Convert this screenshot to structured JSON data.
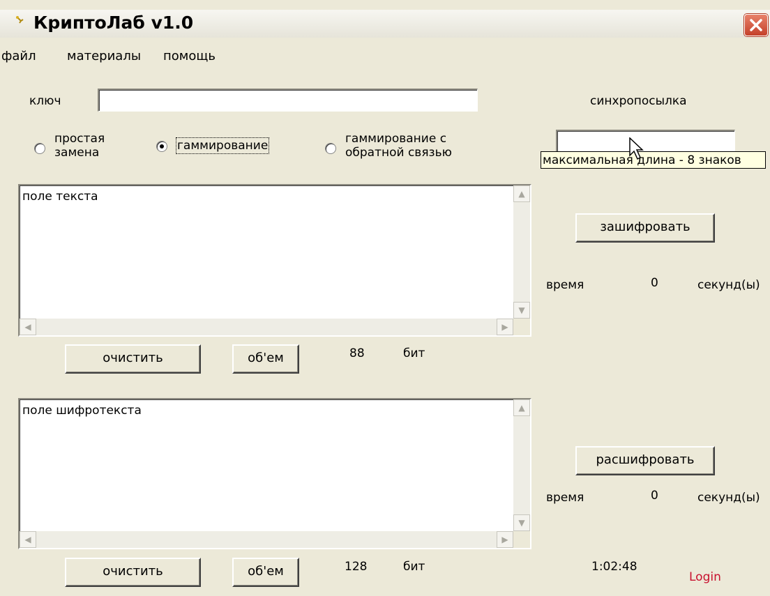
{
  "window": {
    "title": "КриптоЛаб v1.0"
  },
  "menu": {
    "items": [
      "файл",
      "материалы",
      "помощь"
    ]
  },
  "key": {
    "label": "ключ",
    "value": ""
  },
  "sync": {
    "label": "синхропосылка",
    "value": "",
    "tooltip": "максимальная длина - 8 знаков"
  },
  "modes": {
    "simple": {
      "line1": "простая",
      "line2": "замена",
      "checked": false
    },
    "gamma": {
      "label": "гаммирование",
      "checked": true
    },
    "feedback": {
      "line1": "гаммирование с",
      "line2": "обратной связью",
      "checked": false
    }
  },
  "plaintext": {
    "text": "поле текста",
    "clear_label": "очистить",
    "volume_label": "об'ем",
    "bits": "88",
    "bits_unit": "бит"
  },
  "ciphertext": {
    "text": "поле шифротекста",
    "clear_label": "очистить",
    "volume_label": "об'ем",
    "bits": "128",
    "bits_unit": "бит"
  },
  "encrypt": {
    "label": "зашифровать",
    "time_label": "время",
    "time_value": "0",
    "time_unit": "секунд(ы)"
  },
  "decrypt": {
    "label": "расшифровать",
    "time_label": "время",
    "time_value": "0",
    "time_unit": "секунд(ы)"
  },
  "status": {
    "clock": "1:02:48",
    "login": "Login"
  },
  "colors": {
    "login": "#c8102e",
    "tooltip_bg": "#ffffe1",
    "window_bg": "#ece9d8"
  }
}
